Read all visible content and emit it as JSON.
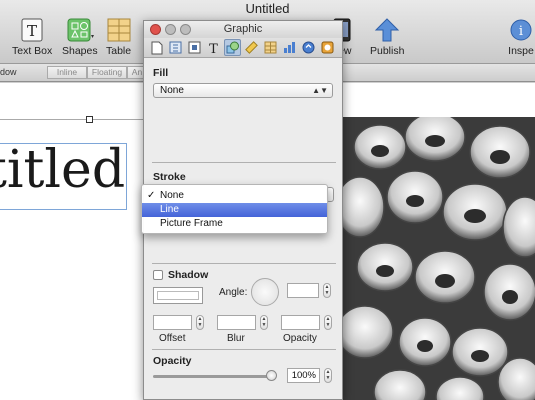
{
  "window": {
    "title": "Untitled"
  },
  "toolbar": {
    "items": [
      {
        "label": "Text Box",
        "icon": "text-box-icon"
      },
      {
        "label": "Shapes",
        "icon": "shapes-icon"
      },
      {
        "label": "Table",
        "icon": "table-icon"
      },
      {
        "label": "view",
        "icon": "preview-icon"
      },
      {
        "label": "Publish",
        "icon": "publish-icon"
      },
      {
        "label": "Inspe",
        "icon": "inspector-icon"
      }
    ]
  },
  "format_bar": {
    "label": "dow",
    "wrap_segments": [
      "Inline",
      "Floating",
      "An"
    ]
  },
  "document": {
    "text": "titled"
  },
  "inspector": {
    "title": "Graphic",
    "tabs": [
      "document",
      "layout",
      "wrap",
      "text",
      "graphic",
      "metrics",
      "table",
      "chart",
      "link",
      "quicktime"
    ],
    "fill": {
      "label": "Fill",
      "value": "None"
    },
    "stroke": {
      "label": "Stroke",
      "menu": [
        {
          "label": "None",
          "checked": true,
          "selected": false
        },
        {
          "label": "Line",
          "checked": false,
          "selected": true
        },
        {
          "label": "Picture Frame",
          "checked": false,
          "selected": false
        }
      ]
    },
    "shadow": {
      "label": "Shadow",
      "checked": false,
      "angle_label": "Angle:",
      "offset_label": "Offset",
      "blur_label": "Blur",
      "opacity_label": "Opacity"
    },
    "opacity": {
      "label": "Opacity",
      "value": "100%",
      "level": 1.0
    }
  },
  "colors": {
    "accent_selected": "#4a69d9",
    "textbox_border": "#7ea6d8"
  }
}
